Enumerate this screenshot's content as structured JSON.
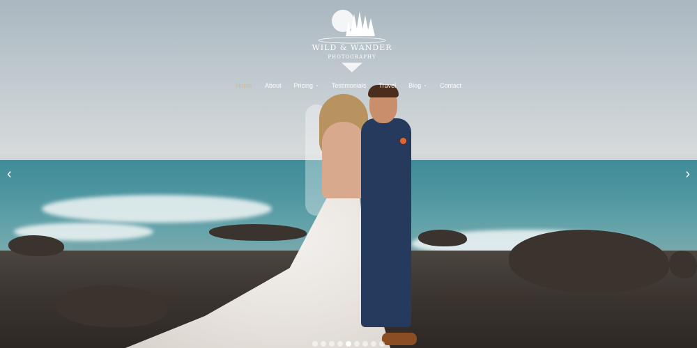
{
  "logo": {
    "line1": "WILD & WANDER",
    "line2": "PHOTOGRAPHY"
  },
  "nav": {
    "items": [
      {
        "label": "Home",
        "dropdown": false,
        "active": true
      },
      {
        "label": "About",
        "dropdown": false,
        "active": false
      },
      {
        "label": "Pricing",
        "dropdown": true,
        "active": false
      },
      {
        "label": "Testimonials",
        "dropdown": false,
        "active": false
      },
      {
        "label": "Travel",
        "dropdown": false,
        "active": false
      },
      {
        "label": "Blog",
        "dropdown": true,
        "active": false
      },
      {
        "label": "Contact",
        "dropdown": false,
        "active": false
      }
    ]
  },
  "slider": {
    "prev_icon": "chevron-left-icon",
    "next_icon": "chevron-right-icon",
    "prev_glyph": "‹",
    "next_glyph": "›",
    "dot_count": 9,
    "active_dot": 4
  },
  "colors": {
    "active_nav": "#d8b98a",
    "nav_text": "#ffffff"
  }
}
